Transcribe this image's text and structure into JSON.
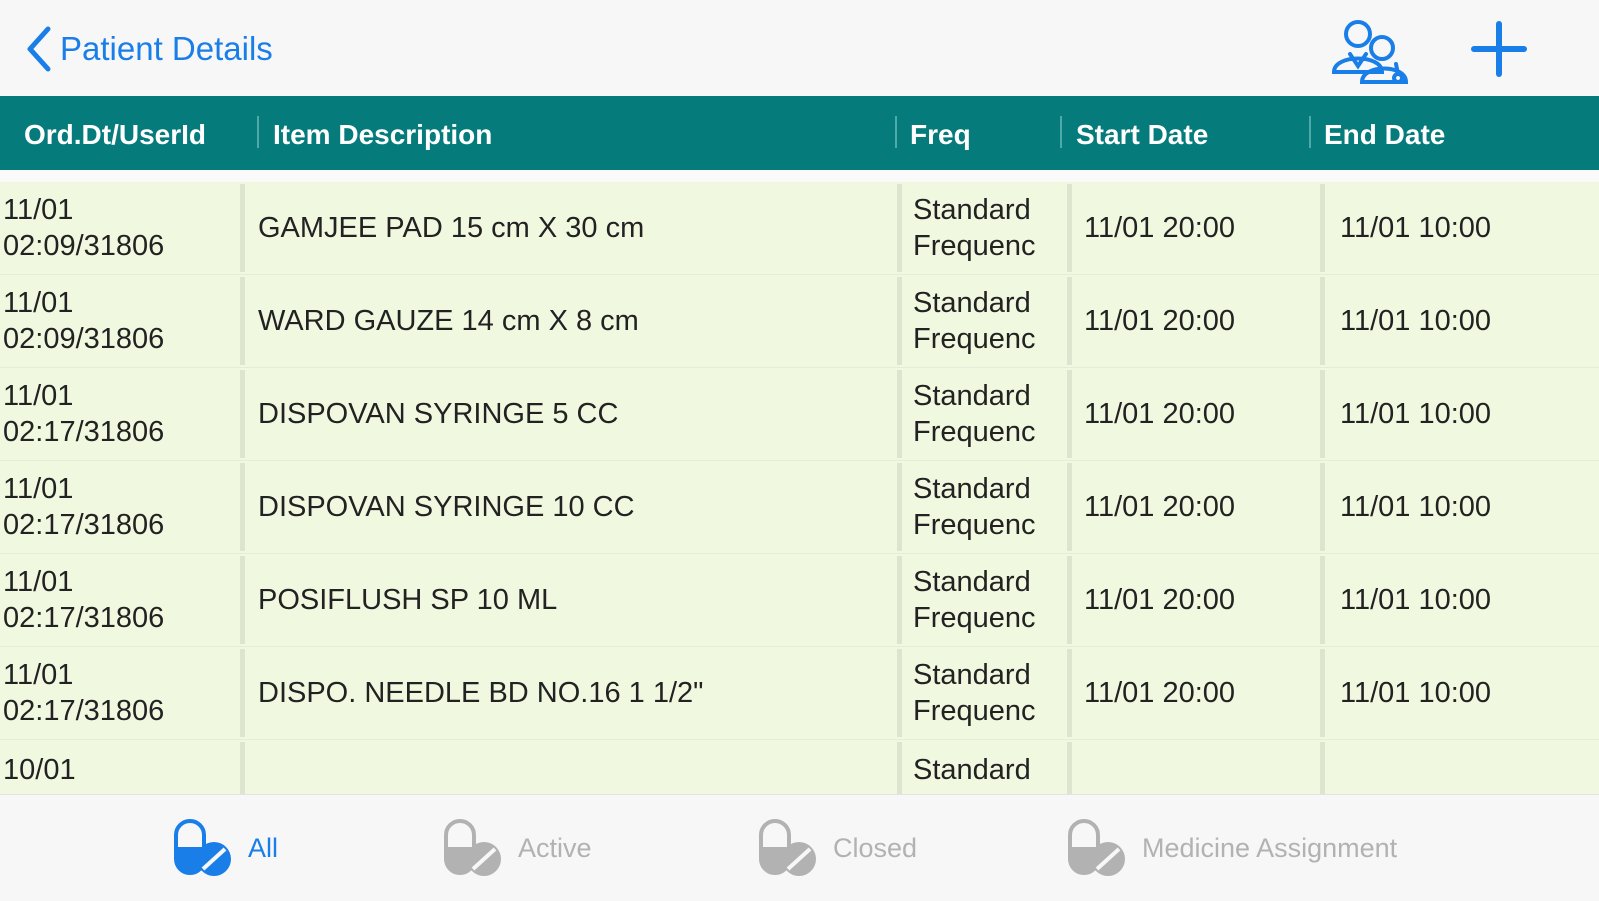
{
  "nav": {
    "back_label": "Patient Details"
  },
  "table": {
    "headers": {
      "order": "Ord.Dt/UserId",
      "item": "Item Description",
      "freq": "Freq",
      "start": "Start Date",
      "end": "End Date"
    },
    "rows": [
      {
        "order_date": "11/01",
        "order_time_user": "02:09/31806",
        "item": "GAMJEE PAD 15 cm X 30 cm",
        "freq_line1": "Standard",
        "freq_line2": "Frequenc",
        "start": "11/01 20:00",
        "end": "11/01 10:00"
      },
      {
        "order_date": "11/01",
        "order_time_user": "02:09/31806",
        "item": "WARD GAUZE 14 cm X 8 cm",
        "freq_line1": "Standard",
        "freq_line2": "Frequenc",
        "start": "11/01 20:00",
        "end": "11/01 10:00"
      },
      {
        "order_date": "11/01",
        "order_time_user": "02:17/31806",
        "item": "DISPOVAN SYRINGE 5 CC",
        "freq_line1": "Standard",
        "freq_line2": "Frequenc",
        "start": "11/01 20:00",
        "end": "11/01 10:00"
      },
      {
        "order_date": "11/01",
        "order_time_user": "02:17/31806",
        "item": "DISPOVAN SYRINGE 10 CC",
        "freq_line1": "Standard",
        "freq_line2": "Frequenc",
        "start": "11/01 20:00",
        "end": "11/01 10:00"
      },
      {
        "order_date": "11/01",
        "order_time_user": "02:17/31806",
        "item": "POSIFLUSH SP 10 ML",
        "freq_line1": "Standard",
        "freq_line2": "Frequenc",
        "start": "11/01 20:00",
        "end": "11/01 10:00"
      },
      {
        "order_date": "11/01",
        "order_time_user": "02:17/31806",
        "item": "DISPO. NEEDLE BD NO.16 1 1/2\"",
        "freq_line1": "Standard",
        "freq_line2": "Frequenc",
        "start": "11/01 20:00",
        "end": "11/01 10:00"
      },
      {
        "order_date": "10/01",
        "order_time_user": "",
        "item": "",
        "freq_line1": "Standard",
        "freq_line2": "",
        "start": "",
        "end": ""
      }
    ]
  },
  "tabs": [
    {
      "label": "All"
    },
    {
      "label": "Active"
    },
    {
      "label": "Closed"
    },
    {
      "label": "Medicine Assignment"
    }
  ],
  "colors": {
    "accent": "#1a7ee8",
    "header_bg": "#067b7c",
    "row_bg": "#f1f8e0",
    "inactive": "#b2b2b2"
  },
  "icons": {
    "back": "chevron-left-icon",
    "doctors": "doctors-group-icon",
    "add": "plus-icon",
    "tab": "pill-check-icon"
  }
}
